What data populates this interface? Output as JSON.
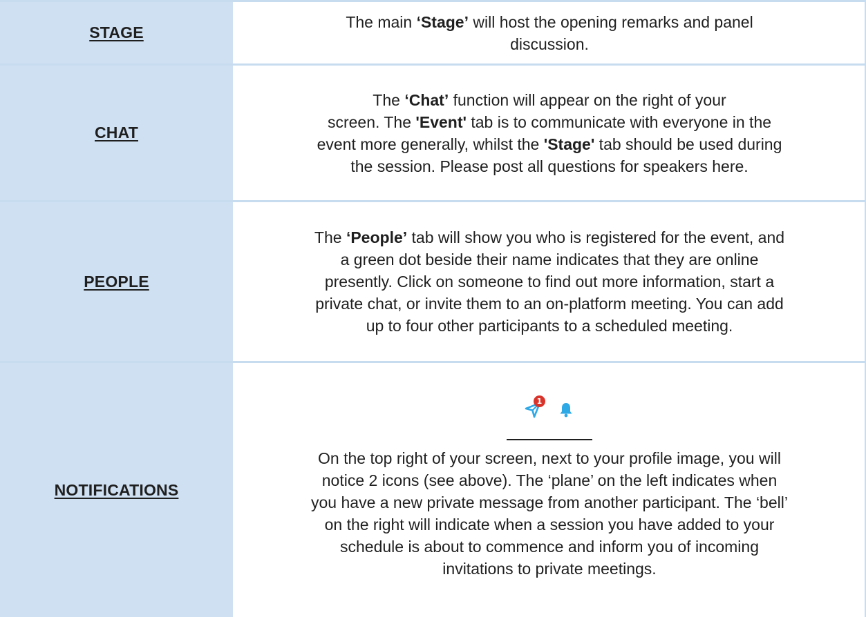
{
  "rows": {
    "stage": {
      "label": "STAGE",
      "line1_pre": "The main ",
      "line1_bold": "‘Stage’",
      "line1_post": " will host the opening remarks and panel",
      "line2": "discussion."
    },
    "chat": {
      "label": "CHAT",
      "line1_pre": "The ",
      "line1_bold": "‘Chat’",
      "line1_post": " function will appear on the right of your",
      "line2_pre": "screen. The ",
      "line2_bold": "'Event'",
      "line2_post": " tab is to communicate with everyone in the",
      "line3_pre": "event more generally, whilst the ",
      "line3_bold": "'Stage'",
      "line3_post": " tab should be used during",
      "line4": "the session. Please post all questions for speakers here."
    },
    "people": {
      "label": "PEOPLE",
      "line1_pre": "The ",
      "line1_bold": "‘People’",
      "line1_post": " tab will show you who is registered for the event, and",
      "line2": "a green dot beside their name indicates that they are online",
      "line3": "presently. Click on someone to find out more information, start a",
      "line4": "private chat, or invite them to an on-platform meeting. You can add",
      "line5": "up to four other participants to a scheduled meeting."
    },
    "notifications": {
      "label": "NOTIFICATIONS",
      "badge_count": "1",
      "line1": "On the top right of your screen, next to your profile image, you will",
      "line2": "notice 2 icons (see above). The ‘plane’ on the left indicates when",
      "line3": "you have a new private message from another participant. The ‘bell’",
      "line4": "on the right will indicate when a session you have added to your",
      "line5": "schedule is about to commence and inform you of incoming",
      "line6": "invitations to private meetings."
    }
  },
  "colors": {
    "label_background": "#cfe0f3",
    "border": "#c8dcef",
    "icon_blue": "#2fa8e6",
    "badge_red": "#d9342b"
  },
  "icons": [
    "paper-plane-icon",
    "bell-icon"
  ]
}
